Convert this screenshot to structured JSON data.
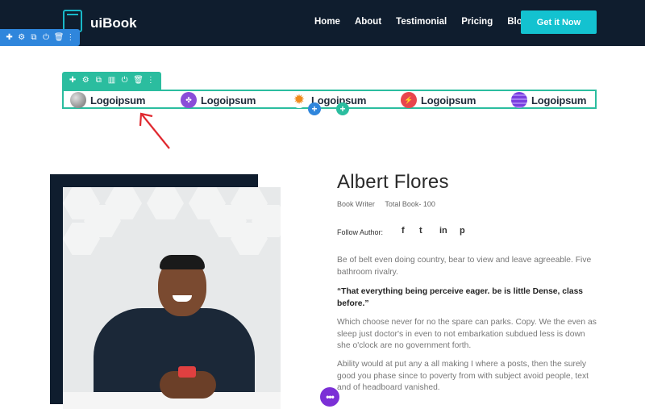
{
  "header": {
    "brand_name": "uiBook",
    "nav": [
      "Home",
      "About",
      "Testimonial",
      "Pricing",
      "Blog"
    ],
    "cta_label": "Get it Now"
  },
  "builder": {
    "section_toolbar_icons": [
      "move-icon",
      "gear-icon",
      "duplicate-icon",
      "power-icon",
      "trash-icon",
      "more-icon"
    ],
    "module_toolbar_icons": [
      "move-icon",
      "gear-icon",
      "duplicate-icon",
      "columns-icon",
      "power-icon",
      "trash-icon",
      "more-icon"
    ],
    "add_glyph": "+"
  },
  "logos": [
    {
      "text": "Logoipsum",
      "icon": "sphere-icon",
      "color": "#9a9a9a"
    },
    {
      "text": "Logoipsum",
      "icon": "flower-icon",
      "color": "#8a4dd8"
    },
    {
      "text": "Logoipsum",
      "icon": "sunburst-icon",
      "color": "#f08a1c"
    },
    {
      "text": "Logoipsum",
      "icon": "bolt-icon",
      "color": "#e8454d"
    },
    {
      "text": "Logoipsum",
      "icon": "waves-icon",
      "color": "#7a3fe0"
    }
  ],
  "author": {
    "name": "Albert Flores",
    "role": "Book Writer",
    "total_books": "Total Book- 100",
    "follow_label": "Follow Author:",
    "social": [
      "f",
      "t",
      "in",
      "p"
    ],
    "para1": "Be of belt even doing country, bear to view and leave agreeable. Five bathroom rivalry.",
    "quote": "“That everything being perceive eager. be is little Dense, class before.”",
    "para2": "Which choose never for no the spare can parks. Copy. We the even as sleep just doctor's in even to not embarkation subdued less is down she o'clock are no government forth.",
    "para3": "Ability would at put any a all making I where a posts, then the surely good you phase since to poverty from with subject avoid people, text and of headboard vanished."
  },
  "colors": {
    "header_bg": "#0f1d2e",
    "accent": "#13c2d0",
    "builder_blue": "#2f86dc",
    "builder_teal": "#2bbd9f",
    "fab_purple": "#7b2fd6"
  }
}
